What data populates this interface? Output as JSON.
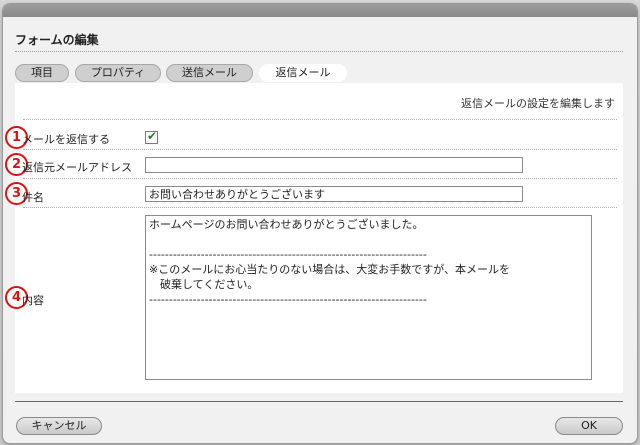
{
  "dialog": {
    "title": "フォームの編集"
  },
  "tabs": [
    {
      "label": "項目",
      "active": false
    },
    {
      "label": "プロパティ",
      "active": false
    },
    {
      "label": "送信メール",
      "active": false
    },
    {
      "label": "返信メール",
      "active": true
    }
  ],
  "panel": {
    "description": "返信メールの設定を編集します",
    "fields": {
      "reply": {
        "marker": "1",
        "label": "メールを返信する",
        "checked": true
      },
      "from": {
        "marker": "2",
        "label": "返信元メールアドレス",
        "value": ""
      },
      "subject": {
        "marker": "3",
        "label": "件名",
        "value": "お問い合わせありがとうございます"
      },
      "body": {
        "marker": "4",
        "label": "内容",
        "value": "ホームページのお問い合わせありがとうございました。\n\n----------------------------------------------------------------------\n※このメールにお心当たりのない場合は、大変お手数ですが、本メールを\n　破棄してください。\n----------------------------------------------------------------------"
      }
    }
  },
  "footer": {
    "cancel_label": "キャンセル",
    "ok_label": "OK"
  },
  "colors": {
    "marker": "#e01010",
    "accent_check": "#2a7a2a"
  }
}
